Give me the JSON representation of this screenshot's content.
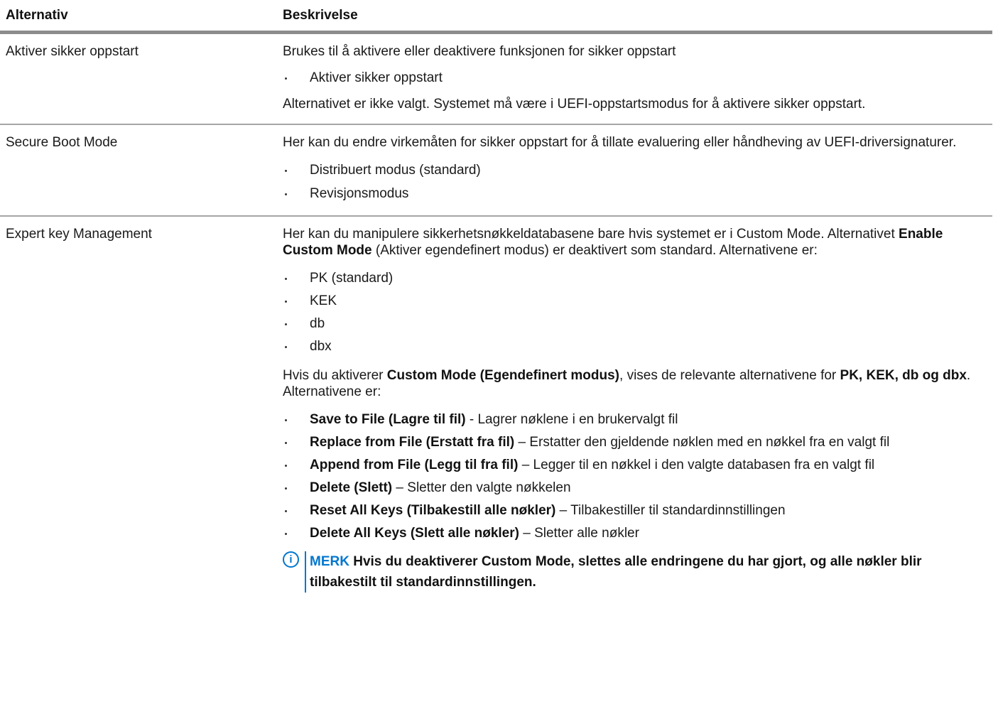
{
  "header": {
    "col1": "Alternativ",
    "col2": "Beskrivelse"
  },
  "rows": [
    {
      "option": "Aktiver sikker oppstart",
      "intro": "Brukes til å aktivere eller deaktivere funksjonen for sikker oppstart",
      "bullets": [
        "Aktiver sikker oppstart"
      ],
      "outro": "Alternativet er ikke valgt. Systemet må være i UEFI-oppstartsmodus for å aktivere sikker oppstart."
    },
    {
      "option": "Secure Boot Mode",
      "intro": "Her kan du endre virkemåten for sikker oppstart for å tillate evaluering eller håndheving av UEFI-driversignaturer.",
      "bullets": [
        "Distribuert modus (standard)",
        "Revisjonsmodus"
      ]
    },
    {
      "option": "Expert key Management",
      "intro_a": "Her kan du manipulere sikkerhetsnøkkeldatabasene bare hvis systemet er i Custom Mode. Alternativet ",
      "intro_bold": "Enable Custom Mode",
      "intro_b": " (Aktiver egendefinert modus) er deaktivert som standard. Alternativene er:",
      "bullets": [
        "PK (standard)",
        "KEK",
        "db",
        "dbx"
      ],
      "mid_a": "Hvis du aktiverer ",
      "mid_bold1": "Custom Mode (Egendefinert modus)",
      "mid_b": ", vises de relevante alternativene for ",
      "mid_bold2": "PK, KEK, db og dbx",
      "mid_c": ". Alternativene er:",
      "actions": [
        {
          "name": "Save to File (Lagre til fil)",
          "desc": " - Lagrer nøklene i en brukervalgt fil"
        },
        {
          "name": "Replace from File (Erstatt fra fil)",
          "desc": " – Erstatter den gjeldende nøklen med en nøkkel fra en valgt fil"
        },
        {
          "name": "Append from File (Legg til fra fil)",
          "desc": " – Legger til en nøkkel i den valgte databasen fra en valgt fil"
        },
        {
          "name": "Delete (Slett)",
          "desc": " – Sletter den valgte nøkkelen"
        },
        {
          "name": "Reset All Keys (Tilbakestill alle nøkler)",
          "desc": " – Tilbakestiller til standardinnstillingen"
        },
        {
          "name": "Delete All Keys (Slett alle nøkler)",
          "desc": " – Sletter alle nøkler"
        }
      ],
      "note": {
        "icon": "info-icon",
        "icon_glyph": "i",
        "label": "MERK",
        "text": " Hvis du deaktiverer Custom Mode, slettes alle endringene du har gjort, og alle nøkler blir tilbakestilt til standardinnstillingen."
      }
    }
  ],
  "colors": {
    "accent": "#0076ce",
    "rule": "#a6a6a6",
    "header_rule": "#8c8c8c"
  }
}
